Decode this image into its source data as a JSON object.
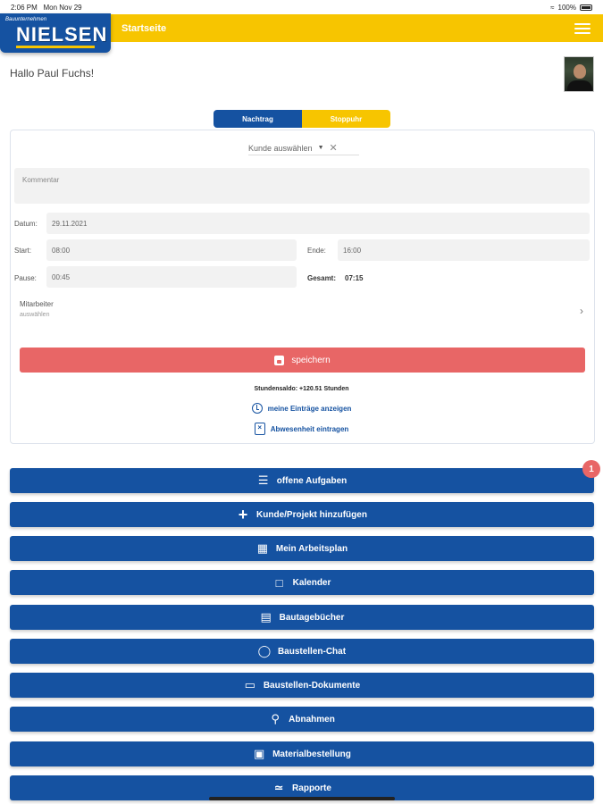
{
  "status_bar": {
    "time": "2:06 PM",
    "date": "Mon Nov 29",
    "battery": "100%"
  },
  "header": {
    "title": "Startseite",
    "logo_small": "Bauunternehmen",
    "logo_big": "NIELSEN"
  },
  "greeting": "Hallo Paul Fuchs!",
  "toggle": {
    "left": "Nachtrag",
    "right": "Stoppuhr"
  },
  "form": {
    "kunde_placeholder": "Kunde auswählen",
    "comment_placeholder": "Kommentar",
    "datum_label": "Datum:",
    "datum_value": "29.11.2021",
    "start_label": "Start:",
    "start_value": "08:00",
    "ende_label": "Ende:",
    "ende_value": "16:00",
    "pause_label": "Pause:",
    "pause_value": "00:45",
    "gesamt_label": "Gesamt:",
    "gesamt_value": "07:15",
    "mitarbeiter_label": "Mitarbeiter",
    "mitarbeiter_value": "auswählen",
    "save_label": "speichern",
    "saldo": "Stundensaldo: +120.51 Stunden",
    "link_entries": "meine Einträge anzeigen",
    "link_absence": "Abwesenheit eintragen"
  },
  "menu": [
    {
      "label": "offene Aufgaben",
      "icon": "task-list-icon",
      "badge": "1"
    },
    {
      "label": "Kunde/Projekt hinzufügen",
      "icon": "plus-icon"
    },
    {
      "label": "Mein Arbeitsplan",
      "icon": "calendar-icon"
    },
    {
      "label": "Kalender",
      "icon": "calendar-icon"
    },
    {
      "label": "Bautagebücher",
      "icon": "book-icon"
    },
    {
      "label": "Baustellen-Chat",
      "icon": "chat-icon"
    },
    {
      "label": "Baustellen-Dokumente",
      "icon": "folder-icon"
    },
    {
      "label": "Abnahmen",
      "icon": "search-icon"
    },
    {
      "label": "Materialbestellung",
      "icon": "cart-icon"
    },
    {
      "label": "Rapporte",
      "icon": "signature-icon"
    }
  ],
  "colors": {
    "primary": "#1552a1",
    "accent": "#f7c500",
    "danger": "#e86666"
  }
}
